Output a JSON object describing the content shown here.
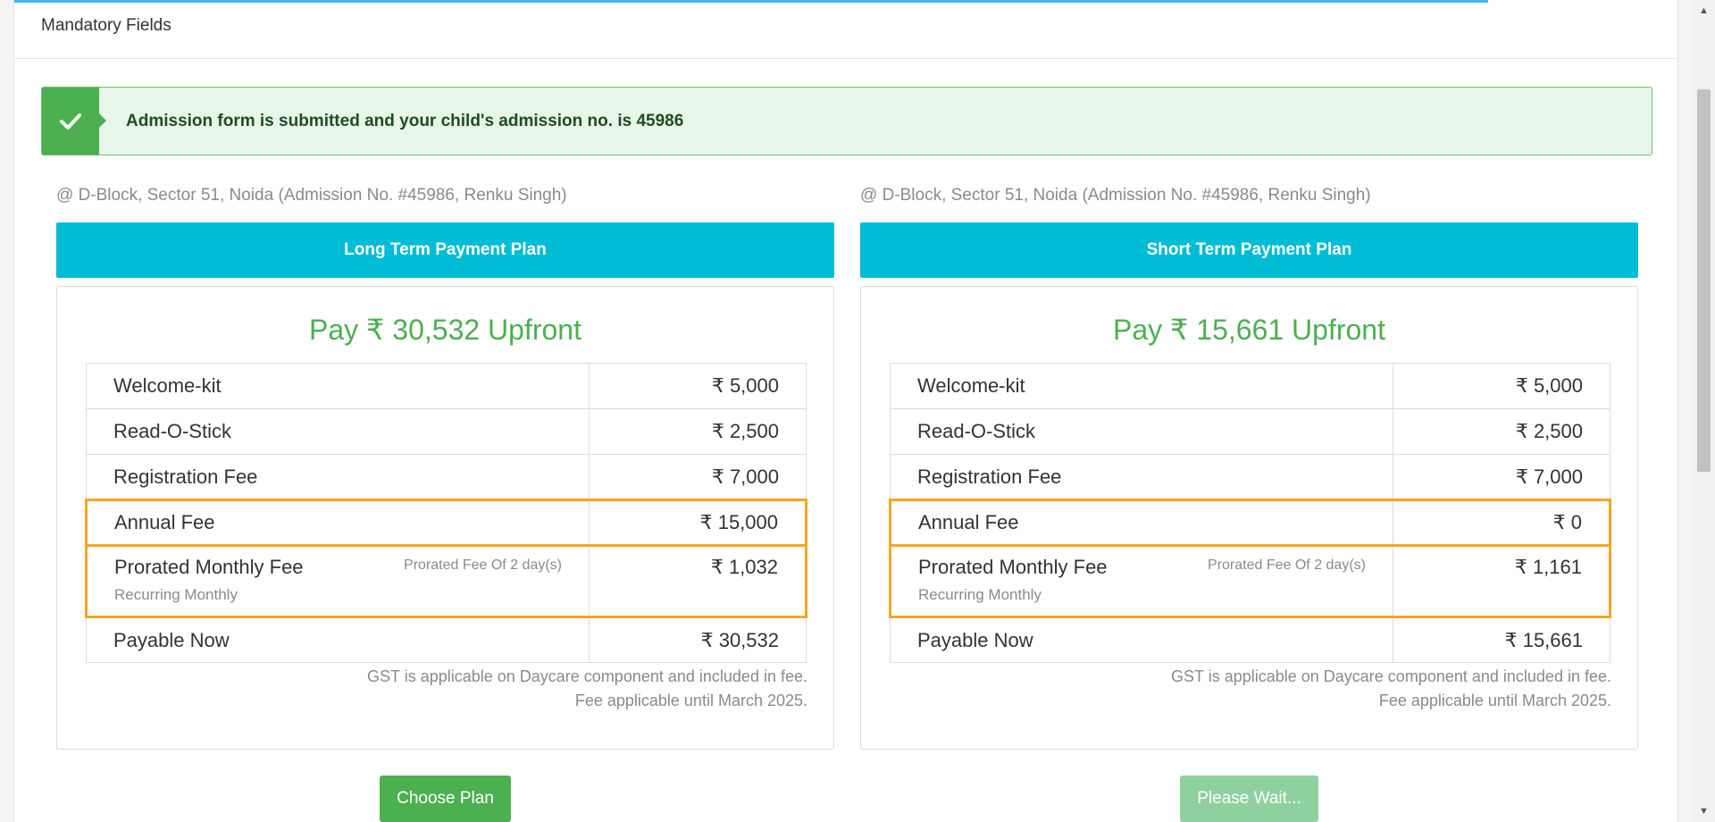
{
  "header": {
    "mandatory_text": "Mandatory Fields"
  },
  "alert": {
    "message": "Admission form is submitted and your child's admission no. is 45986",
    "icon": "check-icon",
    "color": "#4caf50"
  },
  "plans": [
    {
      "location": "@ D-Block, Sector 51, Noida (Admission No. #45986, Renku Singh)",
      "title": "Long Term Payment Plan",
      "upfront": "Pay ₹ 30,532 Upfront",
      "rows": [
        {
          "name": "Welcome-kit",
          "amount": "₹ 5,000"
        },
        {
          "name": "Read-O-Stick",
          "amount": "₹ 2,500"
        },
        {
          "name": "Registration Fee",
          "amount": "₹ 7,000"
        },
        {
          "name": "Annual Fee",
          "amount": "₹ 15,000"
        },
        {
          "name": "Prorated Monthly Fee",
          "note": "Prorated Fee Of 2 day(s)",
          "sub": "Recurring Monthly",
          "amount": "₹ 1,032"
        },
        {
          "name": "Payable Now",
          "amount": "₹ 30,532"
        }
      ],
      "footnote_1": "GST is applicable on Daycare component and included in fee.",
      "footnote_2": "Fee applicable until March 2025.",
      "button_label": "Choose Plan"
    },
    {
      "location": "@ D-Block, Sector 51, Noida (Admission No. #45986, Renku Singh)",
      "title": "Short Term Payment Plan",
      "upfront": "Pay ₹ 15,661 Upfront",
      "rows": [
        {
          "name": "Welcome-kit",
          "amount": "₹ 5,000"
        },
        {
          "name": "Read-O-Stick",
          "amount": "₹ 2,500"
        },
        {
          "name": "Registration Fee",
          "amount": "₹ 7,000"
        },
        {
          "name": "Annual Fee",
          "amount": "₹ 0"
        },
        {
          "name": "Prorated Monthly Fee",
          "note": "Prorated Fee Of 2 day(s)",
          "sub": "Recurring Monthly",
          "amount": "₹ 1,161"
        },
        {
          "name": "Payable Now",
          "amount": "₹ 15,661"
        }
      ],
      "footnote_1": "GST is applicable on Daycare component and included in fee.",
      "footnote_2": "Fee applicable until March 2025.",
      "button_label": "Please Wait..."
    }
  ],
  "colors": {
    "plan_header": "#00bcd4",
    "upfront_text": "#4caf50",
    "highlight_border": "#f5a623",
    "choose_button": "#4caf50",
    "wait_button": "#8fd19e"
  }
}
